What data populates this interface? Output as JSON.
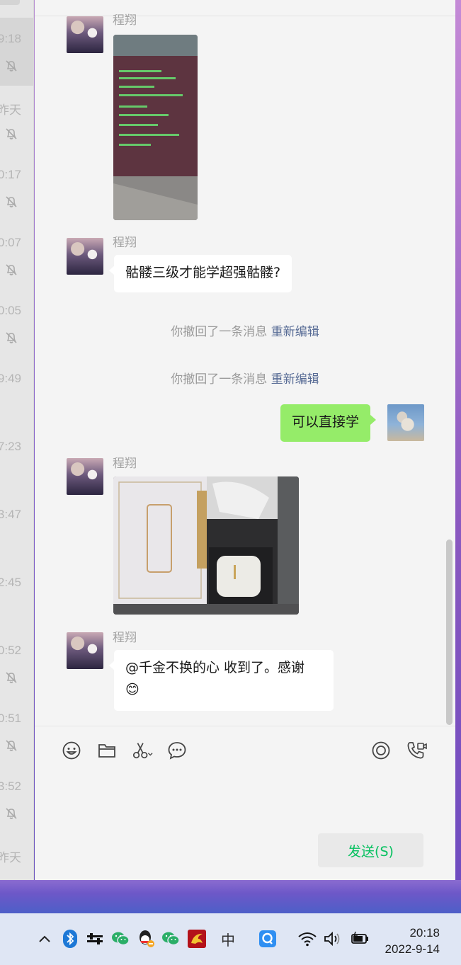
{
  "chat_list": {
    "times": [
      "9:18",
      "昨天",
      "0:17",
      "0:07",
      "0:05",
      "9:49",
      "7:23",
      "3:47",
      "2:45",
      "0:52",
      "0:51",
      "3:52",
      "昨天"
    ]
  },
  "conversation": {
    "sender_name": "程翔",
    "messages": {
      "text1": "骷髅三级才能学超强骷髅?",
      "recall1": "你撤回了一条消息",
      "recall_edit1": "重新编辑",
      "recall2": "你撤回了一条消息",
      "recall_edit2": "重新编辑",
      "my_text": "可以直接学",
      "last_text": "@千金不换的心 收到了。感谢",
      "last_emoji": "😊"
    }
  },
  "input": {
    "send_label": "发送(S)"
  },
  "taskbar": {
    "time": "20:18",
    "date": "2022-9-14",
    "ime": "中"
  },
  "colors": {
    "accent_green": "#07c160",
    "my_bubble": "#95ec69",
    "link_blue": "#576b95"
  }
}
